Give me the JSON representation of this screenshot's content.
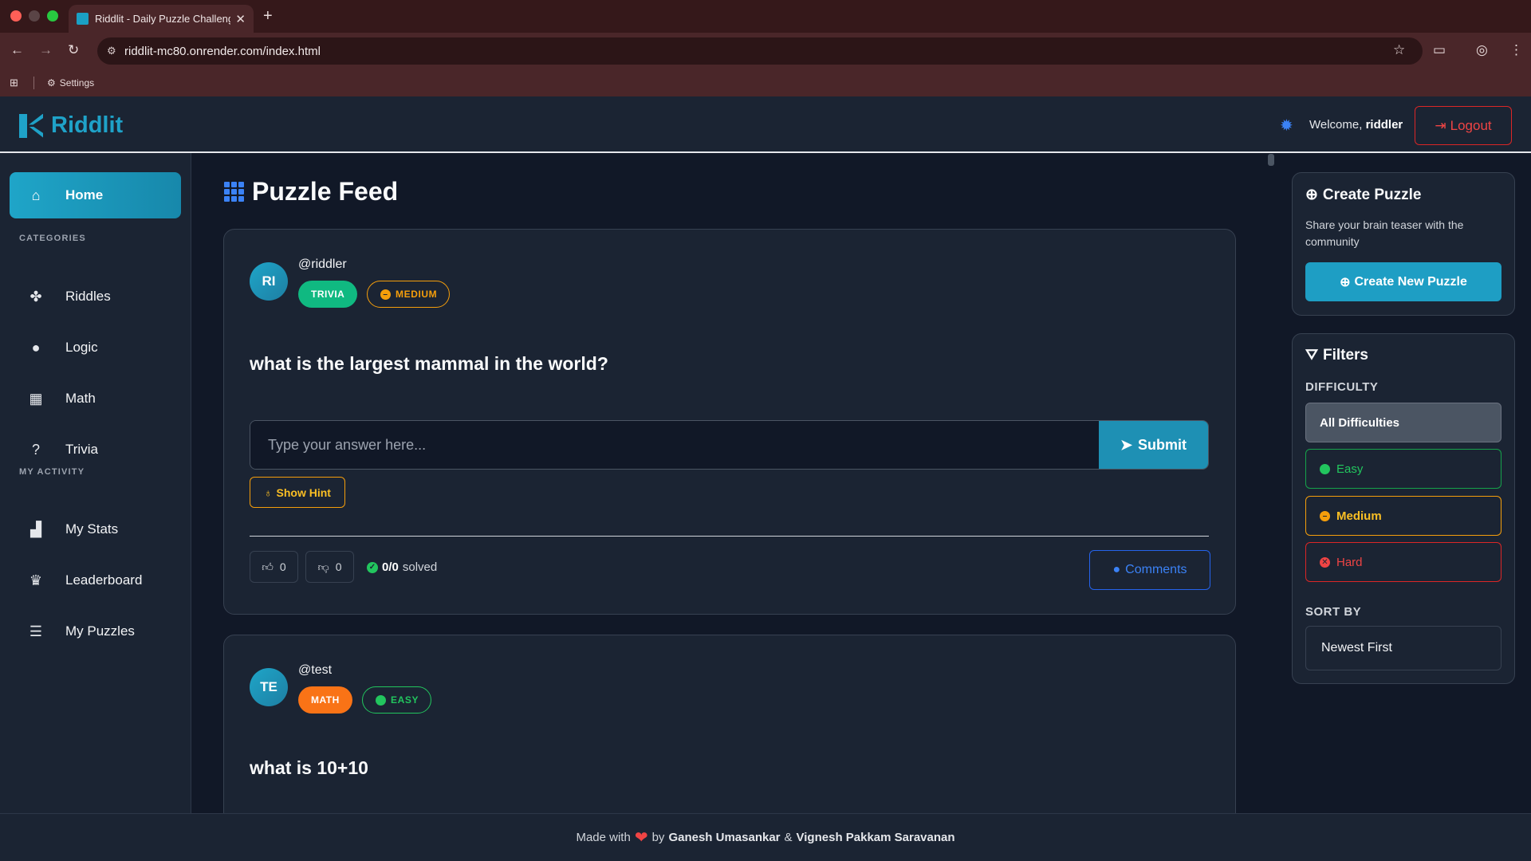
{
  "browser": {
    "tab_title": "Riddlit - Daily Puzzle Challenge",
    "url": "riddlit-mc80.onrender.com/index.html",
    "bookmark_settings": "Settings"
  },
  "header": {
    "logo_text": "Riddlit",
    "welcome_prefix": "Welcome,",
    "username": "riddler",
    "logout_label": "Logout"
  },
  "sidebar": {
    "home_label": "Home",
    "categories_heading": "CATEGORIES",
    "categories": [
      {
        "label": "Riddles",
        "icon": "puzzle-icon"
      },
      {
        "label": "Logic",
        "icon": "lightbulb-icon"
      },
      {
        "label": "Math",
        "icon": "calculator-icon"
      },
      {
        "label": "Trivia",
        "icon": "question-circle-icon"
      }
    ],
    "activity_heading": "MY ACTIVITY",
    "activity": [
      {
        "label": "My Stats",
        "icon": "bar-chart-icon"
      },
      {
        "label": "Leaderboard",
        "icon": "trophy-icon"
      },
      {
        "label": "My Puzzles",
        "icon": "journal-icon"
      }
    ]
  },
  "feed": {
    "title": "Puzzle Feed",
    "posts": [
      {
        "avatar": "RI",
        "author": "@riddler",
        "category": "TRIVIA",
        "difficulty": "MEDIUM",
        "question": "what is the largest mammal in the world?",
        "answer_placeholder": "Type your answer here...",
        "submit_label": "Submit",
        "hint_label": "Show Hint",
        "likes": "0",
        "dislikes": "0",
        "solved_count": "0/0",
        "solved_label": "solved",
        "comments_label": "Comments"
      },
      {
        "avatar": "TE",
        "author": "@test",
        "category": "MATH",
        "difficulty": "EASY",
        "question": "what is 10+10"
      }
    ]
  },
  "create_panel": {
    "title": "Create Puzzle",
    "description": "Share your brain teaser with the community",
    "button_label": "Create New Puzzle"
  },
  "filters": {
    "title": "Filters",
    "difficulty_heading": "DIFFICULTY",
    "options": [
      "All Difficulties",
      "Easy",
      "Medium",
      "Hard"
    ],
    "selected": "All Difficulties",
    "sort_heading": "SORT BY",
    "sort_value": "Newest First"
  },
  "footer": {
    "prefix": "Made with",
    "by": "by",
    "author1": "Ganesh Umasankar",
    "amp": "&",
    "author2": "Vignesh Pakkam Saravanan"
  },
  "colors": {
    "accent": "#1fa2c8",
    "trivia": "#10b981",
    "math": "#f97316",
    "medium": "#f59e0b",
    "easy": "#22c55e",
    "hard": "#dc2626"
  }
}
